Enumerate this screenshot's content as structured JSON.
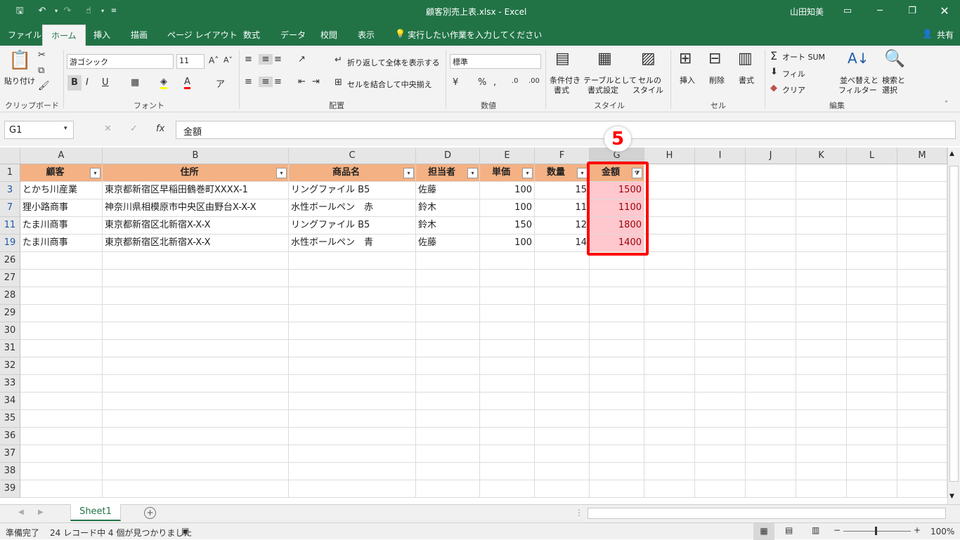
{
  "window": {
    "title": "顧客別売上表.xlsx  -  Excel",
    "user": "山田知美"
  },
  "ribbon_tabs": [
    "ファイル",
    "ホーム",
    "挿入",
    "描画",
    "ページ レイアウト",
    "数式",
    "データ",
    "校閲",
    "表示"
  ],
  "tell_me": "実行したい作業を入力してください",
  "share": "共有",
  "ribbon": {
    "paste": "貼り付け",
    "clipboard": "クリップボード",
    "font_name": "游ゴシック",
    "font_size": "11",
    "font_group": "フォント",
    "wrap_text": "折り返して全体を表示する",
    "merge_center": "セルを結合して中央揃え",
    "alignment_group": "配置",
    "number_format": "標準",
    "number_group": "数値",
    "cond_format": [
      "条件付き",
      "書式"
    ],
    "format_table": [
      "テーブルとして",
      "書式設定"
    ],
    "cell_styles": [
      "セルの",
      "スタイル"
    ],
    "styles_group": "スタイル",
    "insert": "挿入",
    "delete": "削除",
    "format": "書式",
    "cells_group": "セル",
    "autosum": "オート SUM",
    "fill": "フィル",
    "clear": "クリア",
    "sort_filter": [
      "並べ替えと",
      "フィルター"
    ],
    "find_select": [
      "検索と",
      "選択"
    ],
    "editing_group": "編集"
  },
  "formula_bar": {
    "name_box": "G1",
    "formula": "金額"
  },
  "columns": [
    "A",
    "B",
    "C",
    "D",
    "E",
    "F",
    "G",
    "H",
    "I",
    "J",
    "K",
    "L",
    "M"
  ],
  "headers": [
    "顧客",
    "住所",
    "商品名",
    "担当者",
    "単価",
    "数量",
    "金額"
  ],
  "rows": [
    {
      "num": "3",
      "cells": [
        "とかち川産業",
        "東京都新宿区早稲田鶴巻町XXXX-1",
        "リングファイル B5",
        "佐藤",
        "100",
        "15",
        "1500"
      ]
    },
    {
      "num": "7",
      "cells": [
        "狸小路商事",
        "神奈川県相模原市中央区由野台X-X-X",
        "水性ボールペン　赤",
        "鈴木",
        "100",
        "11",
        "1100"
      ]
    },
    {
      "num": "11",
      "cells": [
        "たま川商事",
        "東京都新宿区北新宿X-X-X",
        "リングファイル B5",
        "鈴木",
        "150",
        "12",
        "1800"
      ]
    },
    {
      "num": "19",
      "cells": [
        "たま川商事",
        "東京都新宿区北新宿X-X-X",
        "水性ボールペン　青",
        "佐藤",
        "100",
        "14",
        "1400"
      ]
    }
  ],
  "empty_rows": [
    "26",
    "27",
    "28",
    "29",
    "30",
    "31",
    "32",
    "33",
    "34",
    "35",
    "36",
    "37",
    "38",
    "39"
  ],
  "annotation_badge": "5",
  "sheet_tab": "Sheet1",
  "status": {
    "ready": "準備完了",
    "filter_result": "24 レコード中 4 個が見つかりました",
    "zoom": "100%"
  }
}
